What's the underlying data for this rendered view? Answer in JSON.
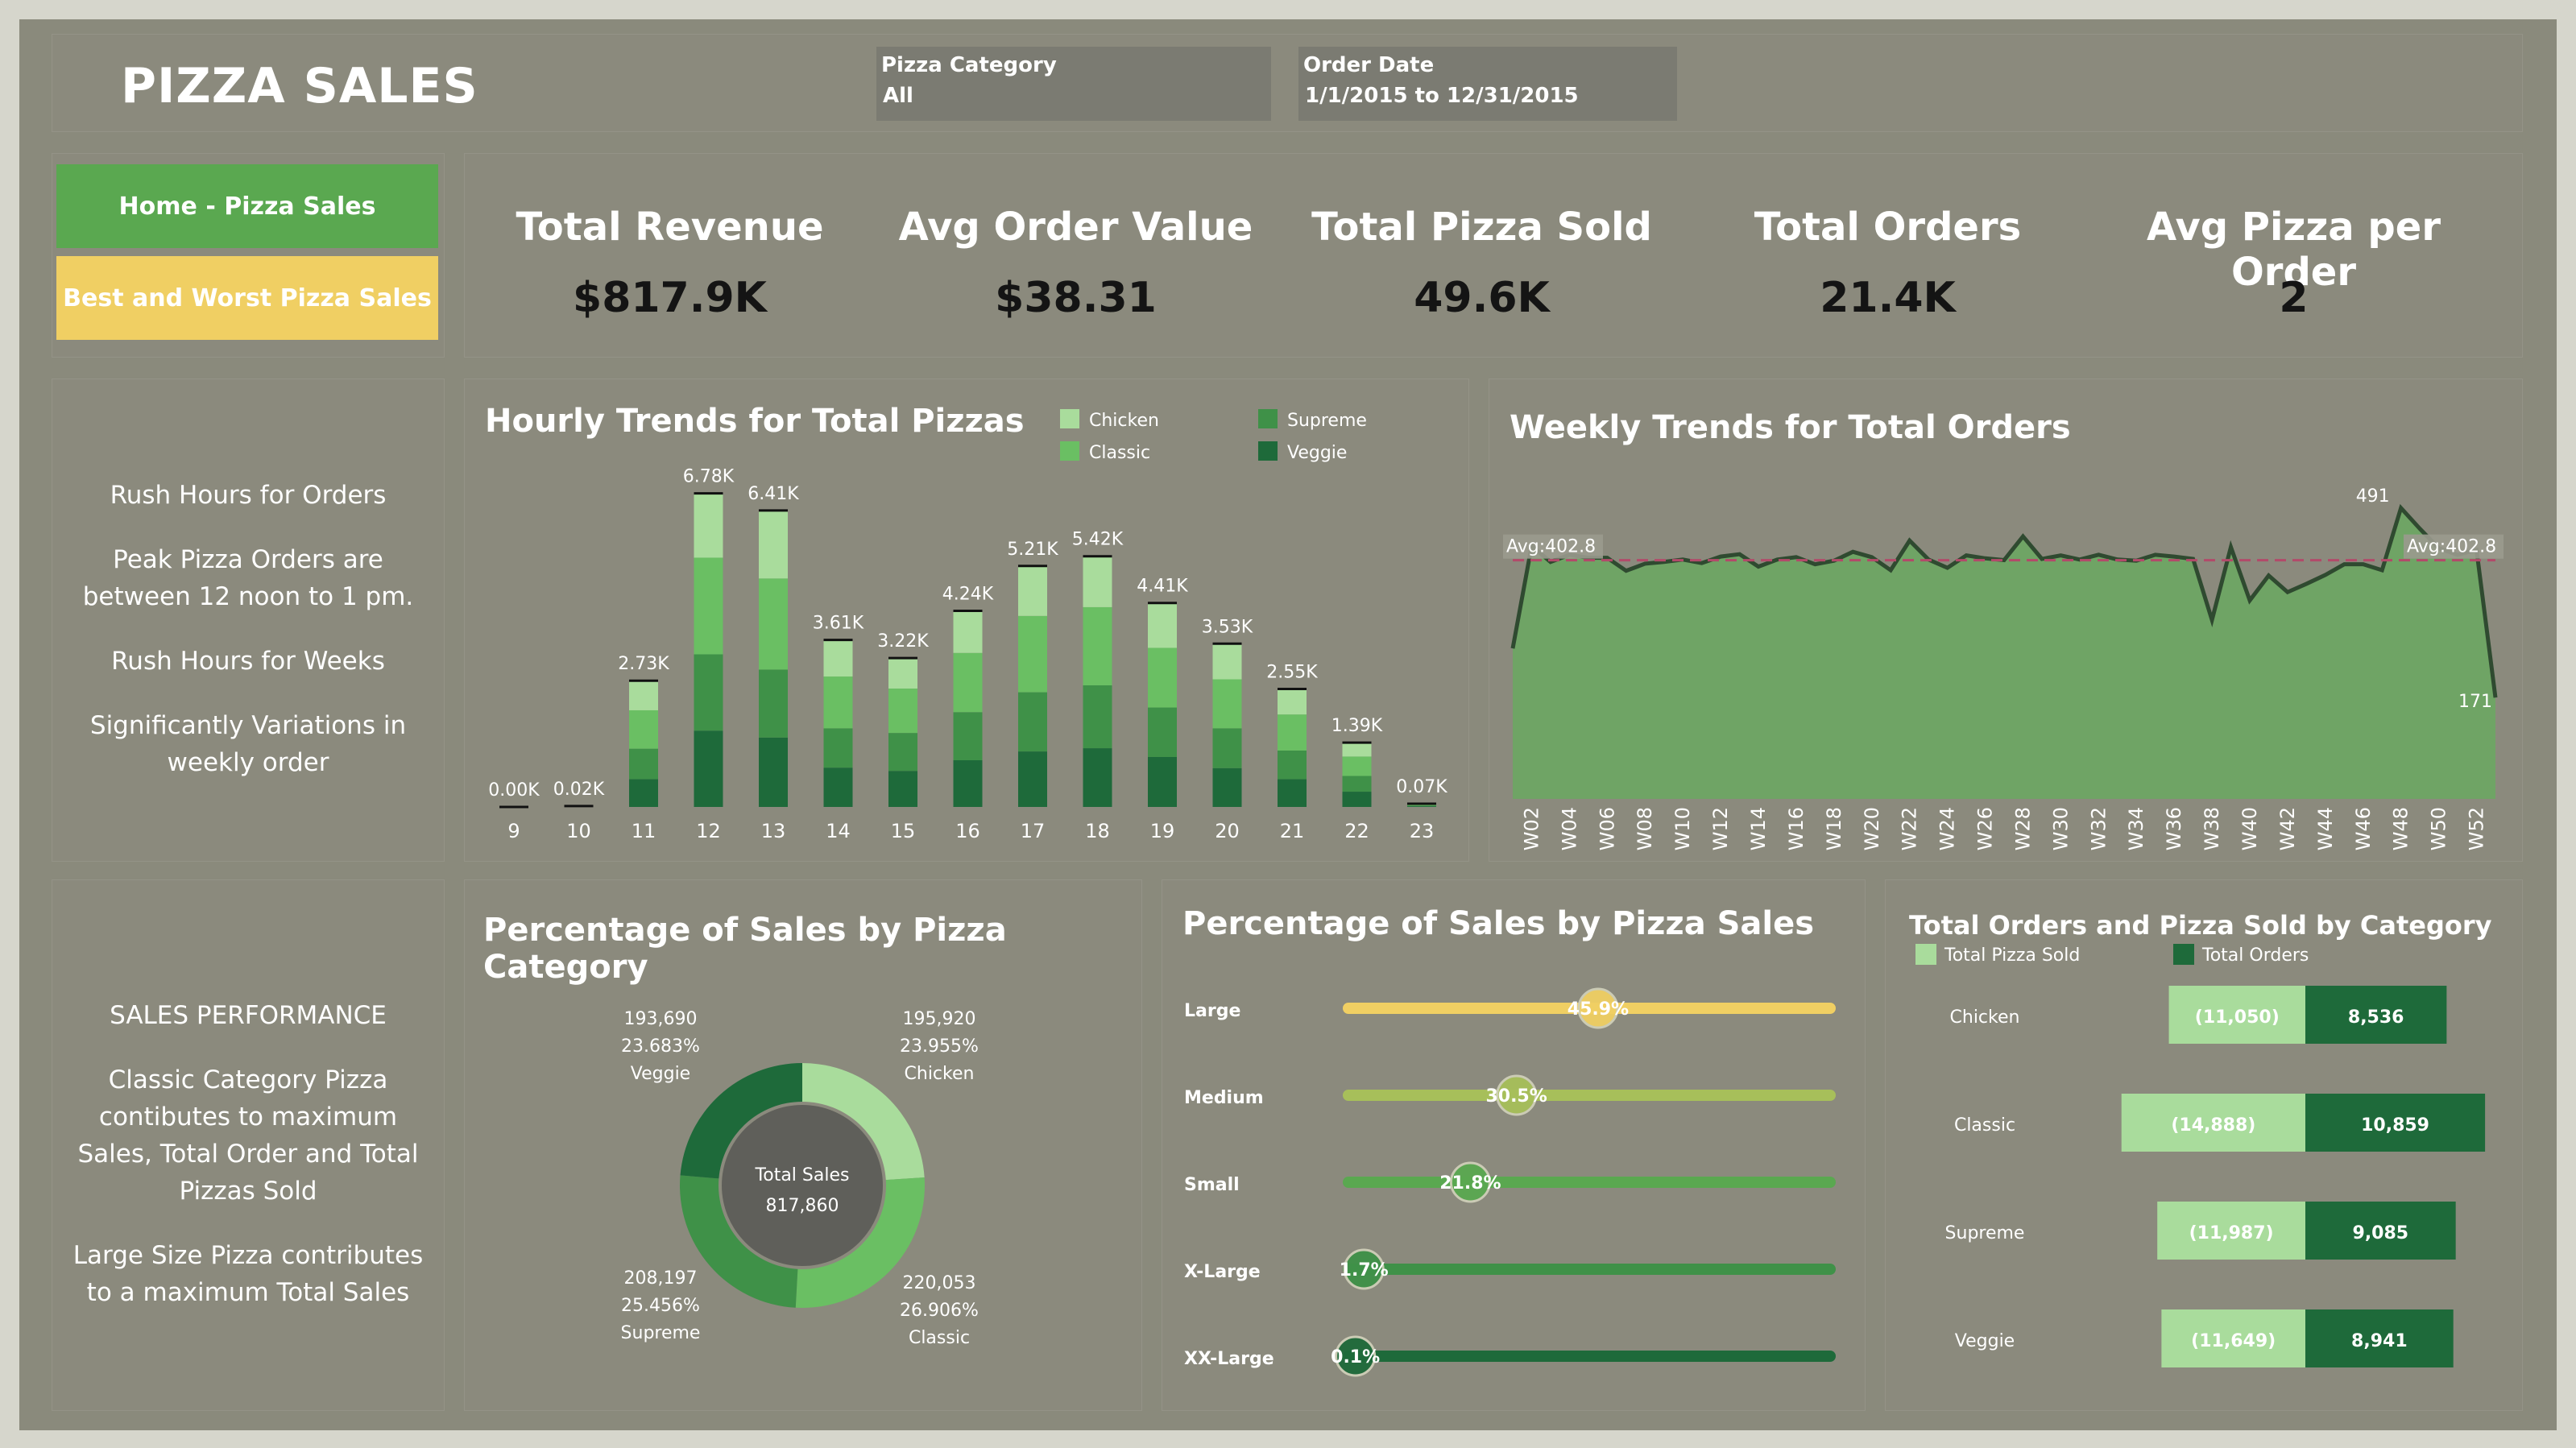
{
  "header": {
    "title": "PIZZA SALES",
    "filters": {
      "category_label": "Pizza Category",
      "category_value": "All",
      "date_label": "Order Date",
      "date_value": "1/1/2015 to 12/31/2015"
    }
  },
  "nav": {
    "home_label": "Home - Pizza Sales",
    "best_worst_label": "Best and Worst Pizza Sales"
  },
  "kpis": [
    {
      "title": "Total Revenue",
      "value": "$817.9K"
    },
    {
      "title": "Avg Order Value",
      "value": "$38.31"
    },
    {
      "title": "Total Pizza Sold",
      "value": "49.6K"
    },
    {
      "title": "Total Orders",
      "value": "21.4K"
    },
    {
      "title": "Avg Pizza per Order",
      "value": "2"
    }
  ],
  "insights_rush": [
    "Rush Hours for Orders",
    "Peak Pizza Orders are between 12 noon to 1 pm.",
    "Rush Hours for Weeks",
    "Significantly Variations in weekly order"
  ],
  "insights_sales": [
    "SALES PERFORMANCE",
    "Classic Category Pizza contibutes to  maximum Sales, Total Order and Total Pizzas Sold",
    "Large Size Pizza contributes to a maximum Total Sales"
  ],
  "colors": {
    "chicken": "#a9dc9c",
    "classic": "#6abf63",
    "supreme": "#3f9148",
    "veggie": "#1e6a3a",
    "home_button": "#5aa850",
    "best_worst_button": "#f0cf63",
    "avg_line": "#b24a6a",
    "area_fill": "#6aa860"
  },
  "chart_data": [
    {
      "id": "hourly",
      "type": "bar",
      "stacked": true,
      "title": "Hourly Trends for Total Pizzas",
      "categories": [
        "9",
        "10",
        "11",
        "12",
        "13",
        "14",
        "15",
        "16",
        "17",
        "18",
        "19",
        "20",
        "21",
        "22",
        "23"
      ],
      "totals_labels": [
        "0.00K",
        "0.02K",
        "2.73K",
        "6.78K",
        "6.41K",
        "3.61K",
        "3.22K",
        "4.24K",
        "5.21K",
        "5.42K",
        "4.41K",
        "3.53K",
        "2.55K",
        "1.39K",
        "0.07K"
      ],
      "legend": [
        "Chicken",
        "Supreme",
        "Classic",
        "Veggie"
      ],
      "series": [
        {
          "name": "Veggie",
          "color": "#1e6a3a",
          "values": [
            0,
            5,
            600,
            1650,
            1500,
            850,
            780,
            1010,
            1200,
            1270,
            1080,
            840,
            600,
            330,
            15
          ]
        },
        {
          "name": "Supreme",
          "color": "#3f9148",
          "values": [
            0,
            5,
            660,
            1650,
            1470,
            850,
            820,
            1040,
            1280,
            1360,
            1070,
            860,
            620,
            340,
            17
          ]
        },
        {
          "name": "Classic",
          "color": "#6abf63",
          "values": [
            0,
            5,
            830,
            2090,
            1970,
            1120,
            960,
            1280,
            1650,
            1690,
            1290,
            1060,
            780,
            420,
            22
          ]
        },
        {
          "name": "Chicken",
          "color": "#a9dc9c",
          "values": [
            0,
            5,
            640,
            1390,
            1470,
            790,
            660,
            910,
            1080,
            1100,
            970,
            770,
            550,
            300,
            16
          ]
        }
      ],
      "ylim": [
        0,
        7000
      ]
    },
    {
      "id": "weekly",
      "type": "area",
      "title": "Weekly Trends for Total Orders",
      "x_ticks": [
        "W02",
        "W04",
        "W06",
        "W08",
        "W10",
        "W12",
        "W14",
        "W16",
        "W18",
        "W20",
        "W22",
        "W24",
        "W26",
        "W28",
        "W30",
        "W32",
        "W34",
        "W36",
        "W38",
        "W40",
        "W42",
        "W44",
        "W46",
        "W48",
        "W50",
        "W52"
      ],
      "x": [
        "W01",
        "W02",
        "W03",
        "W04",
        "W05",
        "W06",
        "W07",
        "W08",
        "W09",
        "W10",
        "W11",
        "W12",
        "W13",
        "W14",
        "W15",
        "W16",
        "W17",
        "W18",
        "W19",
        "W20",
        "W21",
        "W22",
        "W23",
        "W24",
        "W25",
        "W26",
        "W27",
        "W28",
        "W29",
        "W30",
        "W31",
        "W32",
        "W33",
        "W34",
        "W35",
        "W36",
        "W37",
        "W38",
        "W39",
        "W40",
        "W41",
        "W42",
        "W43",
        "W44",
        "W45",
        "W46",
        "W47",
        "W48",
        "W49",
        "W50",
        "W51",
        "W52",
        "W53"
      ],
      "values": [
        254,
        427,
        400,
        412,
        407,
        407,
        385,
        397,
        400,
        404,
        398,
        409,
        413,
        392,
        404,
        408,
        396,
        402,
        417,
        408,
        386,
        436,
        404,
        390,
        411,
        406,
        403,
        443,
        405,
        411,
        404,
        412,
        404,
        402,
        412,
        409,
        405,
        302,
        425,
        335,
        377,
        349,
        363,
        378,
        396,
        396,
        386,
        491,
        456,
        423,
        412,
        420,
        171
      ],
      "avg": 402.8,
      "avg_label": "Avg:402.8",
      "annotations": [
        {
          "label": "491",
          "value": 491
        },
        {
          "label": "171",
          "value": 171
        }
      ],
      "ylim": [
        0,
        560
      ]
    },
    {
      "id": "category_donut",
      "type": "pie",
      "donut": true,
      "title": "Percentage of Sales by Pizza Category",
      "center_label": "Total Sales",
      "center_value": "817,860",
      "slices": [
        {
          "name": "Chicken",
          "value": 195920,
          "value_label": "195,920",
          "pct": "23.955%",
          "color": "#a9dc9c"
        },
        {
          "name": "Classic",
          "value": 220053,
          "value_label": "220,053",
          "pct": "26.906%",
          "color": "#6abf63"
        },
        {
          "name": "Supreme",
          "value": 208197,
          "value_label": "208,197",
          "pct": "25.456%",
          "color": "#3f9148"
        },
        {
          "name": "Veggie",
          "value": 193690,
          "value_label": "193,690",
          "pct": "23.683%",
          "color": "#1e6a3a"
        }
      ]
    },
    {
      "id": "size_lollipop",
      "type": "bar",
      "title": "Percentage of Sales by Pizza Sales",
      "items": [
        {
          "name": "Large",
          "pct": 45.9,
          "label": "45.9%",
          "color": "#f0cf63"
        },
        {
          "name": "Medium",
          "pct": 30.5,
          "label": "30.5%",
          "color": "#a7bf5a"
        },
        {
          "name": "Small",
          "pct": 21.8,
          "label": "21.8%",
          "color": "#5aa850"
        },
        {
          "name": "X-Large",
          "pct": 1.7,
          "label": "1.7%",
          "color": "#3f9148"
        },
        {
          "name": "XX-Large",
          "pct": 0.1,
          "label": "0.1%",
          "color": "#1e6a3a"
        }
      ]
    },
    {
      "id": "orders_sold",
      "type": "bar",
      "title": "Total Orders and Pizza Sold by Category",
      "legend": [
        "Total Pizza Sold",
        "Total Orders"
      ],
      "rows": [
        {
          "category": "Chicken",
          "pizza_sold": 11050,
          "pizza_sold_label": "(11,050)",
          "orders": 8536,
          "orders_label": "8,536"
        },
        {
          "category": "Classic",
          "pizza_sold": 14888,
          "pizza_sold_label": "(14,888)",
          "orders": 10859,
          "orders_label": "10,859"
        },
        {
          "category": "Supreme",
          "pizza_sold": 11987,
          "pizza_sold_label": "(11,987)",
          "orders": 9085,
          "orders_label": "9,085"
        },
        {
          "category": "Veggie",
          "pizza_sold": 11649,
          "pizza_sold_label": "(11,649)",
          "orders": 8941,
          "orders_label": "8,941"
        }
      ]
    }
  ]
}
